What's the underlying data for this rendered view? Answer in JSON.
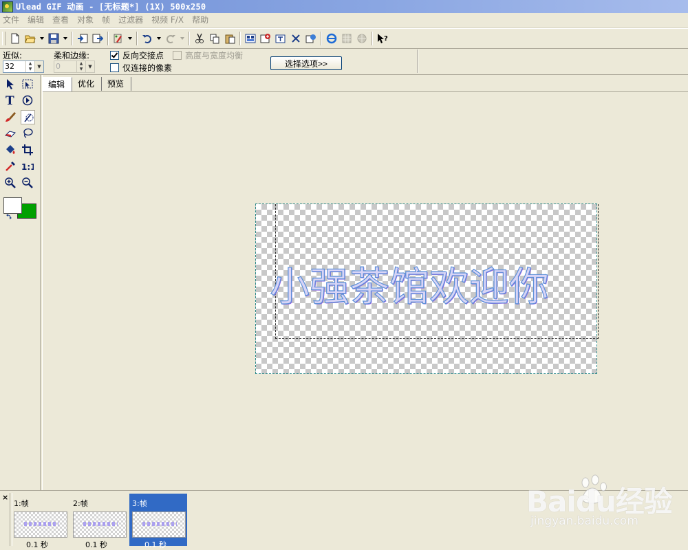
{
  "window": {
    "title": "Ulead GIF 动画 - [无标题*] (1X) 500x250"
  },
  "menu": [
    "文件",
    "编辑",
    "查看",
    "对象",
    "帧",
    "过滤器",
    "视频 F/X",
    "帮助"
  ],
  "options": {
    "similarity_label": "近似:",
    "similarity_value": "32",
    "soft_edge_label": "柔和边缘:",
    "soft_edge_value": "0",
    "invert_label": "反向交接点",
    "connected_label": "仅连接的像素",
    "aspect_label": "高度与宽度均衡",
    "select_options_label": "选择选项>>"
  },
  "tabs": [
    "编辑",
    "优化",
    "预览"
  ],
  "canvas": {
    "text": "小强茶馆欢迎你"
  },
  "colors": {
    "foreground": "#ffffff",
    "background": "#00a000",
    "title_bar": "#7b98dc",
    "selected_frame": "#316ac5"
  },
  "frames": [
    {
      "label": "1:帧",
      "delay": "0.1 秒"
    },
    {
      "label": "2:帧",
      "delay": "0.1 秒"
    },
    {
      "label": "3:帧",
      "delay": "0.1 秒"
    }
  ],
  "frame_panel": {
    "close_glyph": "×"
  },
  "watermark": {
    "brand": "Baidu经验",
    "url": "jingyan.baidu.com"
  }
}
